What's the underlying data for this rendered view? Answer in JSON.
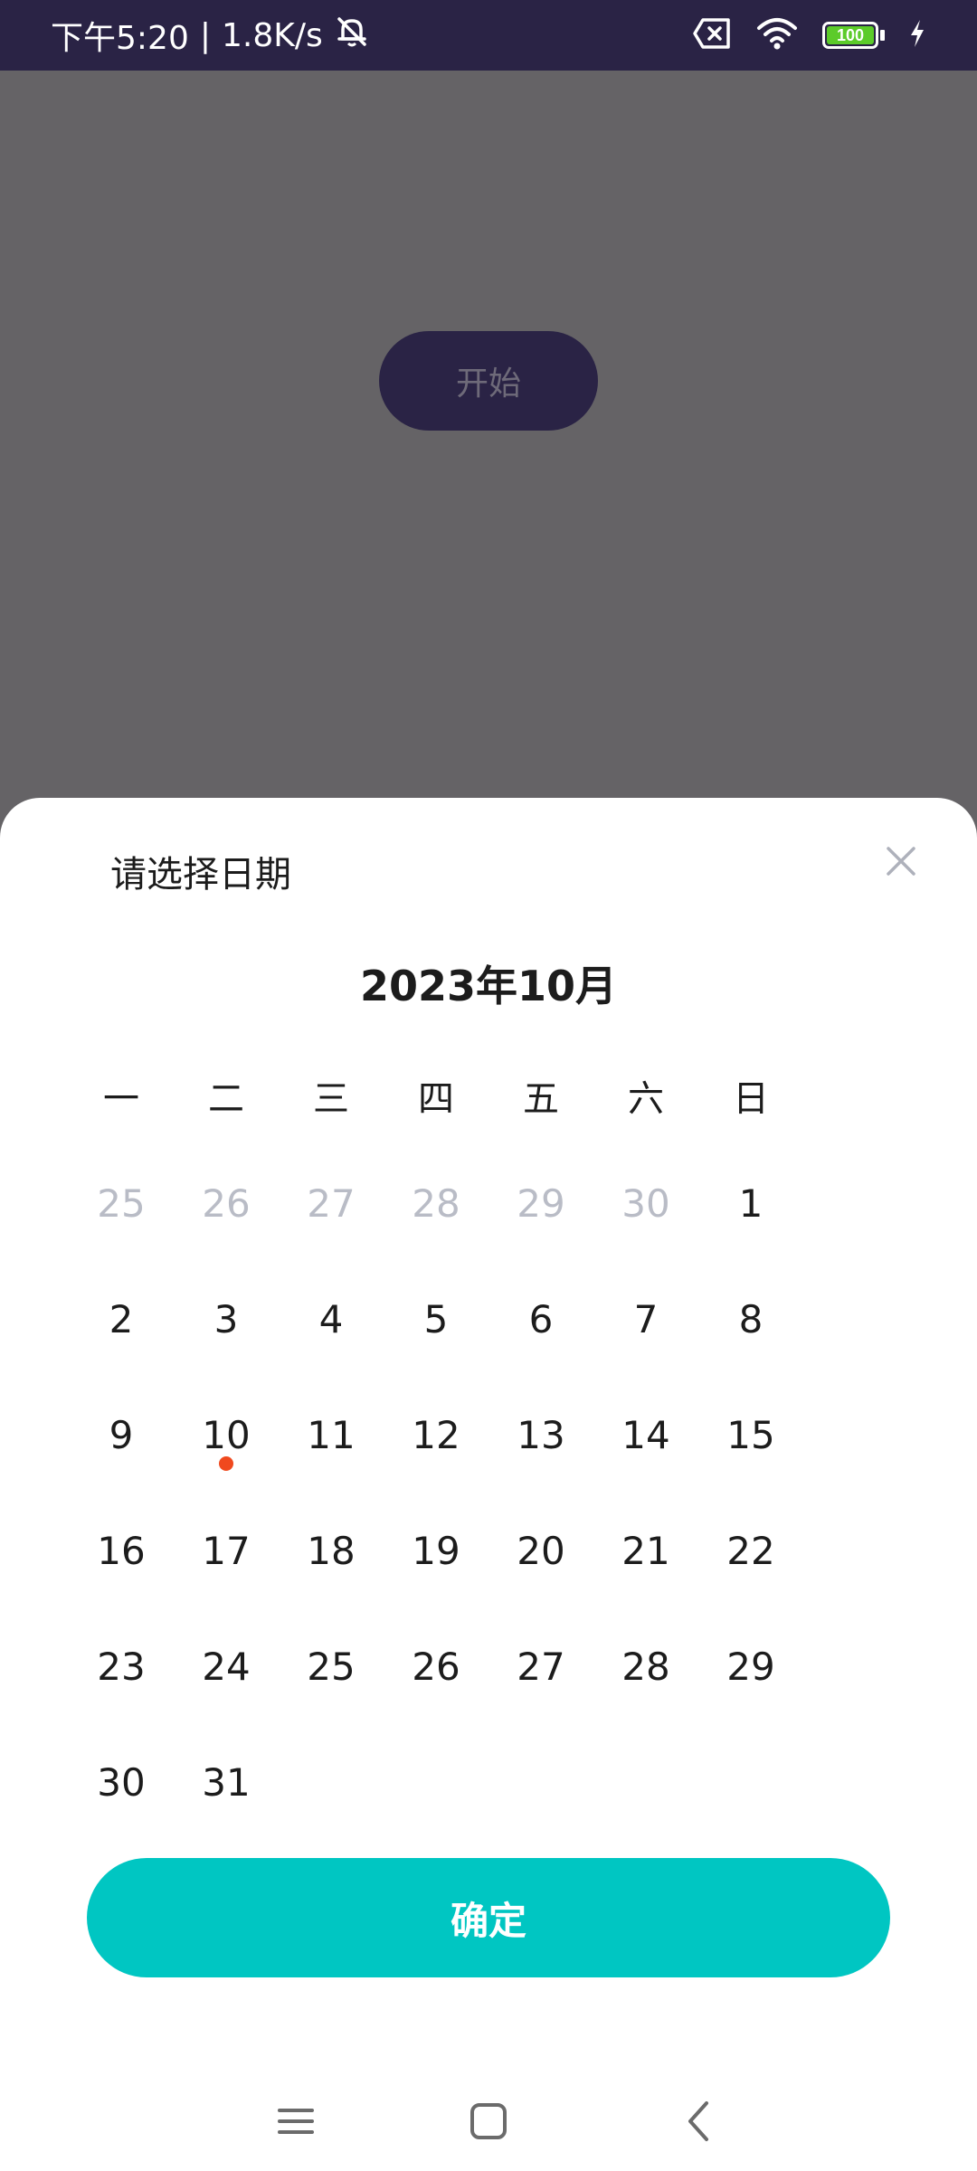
{
  "status_bar": {
    "time": "下午5:20",
    "separator": "|",
    "network_speed": "1.8K/s",
    "icons": [
      "mute-icon",
      "sim-x-icon",
      "wifi-icon",
      "battery-icon",
      "charging-icon"
    ],
    "battery_level": "100"
  },
  "background": {
    "start_button_label": "开始"
  },
  "date_picker": {
    "title": "请选择日期",
    "close_icon": "close-icon",
    "month_label": "2023年10月",
    "weekdays": [
      "一",
      "二",
      "三",
      "四",
      "五",
      "六",
      "日"
    ],
    "days": [
      {
        "label": "25",
        "muted": true
      },
      {
        "label": "26",
        "muted": true
      },
      {
        "label": "27",
        "muted": true
      },
      {
        "label": "28",
        "muted": true
      },
      {
        "label": "29",
        "muted": true
      },
      {
        "label": "30",
        "muted": true
      },
      {
        "label": "1"
      },
      {
        "label": "2"
      },
      {
        "label": "3"
      },
      {
        "label": "4"
      },
      {
        "label": "5"
      },
      {
        "label": "6"
      },
      {
        "label": "7"
      },
      {
        "label": "8"
      },
      {
        "label": "9"
      },
      {
        "label": "10",
        "today": true
      },
      {
        "label": "11"
      },
      {
        "label": "12"
      },
      {
        "label": "13"
      },
      {
        "label": "14"
      },
      {
        "label": "15"
      },
      {
        "label": "16"
      },
      {
        "label": "17"
      },
      {
        "label": "18"
      },
      {
        "label": "19"
      },
      {
        "label": "20"
      },
      {
        "label": "21"
      },
      {
        "label": "22"
      },
      {
        "label": "23"
      },
      {
        "label": "24"
      },
      {
        "label": "25"
      },
      {
        "label": "26"
      },
      {
        "label": "27"
      },
      {
        "label": "28"
      },
      {
        "label": "29"
      },
      {
        "label": "30"
      },
      {
        "label": "31"
      }
    ],
    "confirm_label": "确定",
    "colors": {
      "accent": "#00c6c2",
      "today_dot": "#f0491e",
      "muted_day": "#b9bcc6"
    }
  },
  "nav_bar": {
    "buttons": [
      "menu-icon",
      "home-icon",
      "back-icon"
    ]
  }
}
